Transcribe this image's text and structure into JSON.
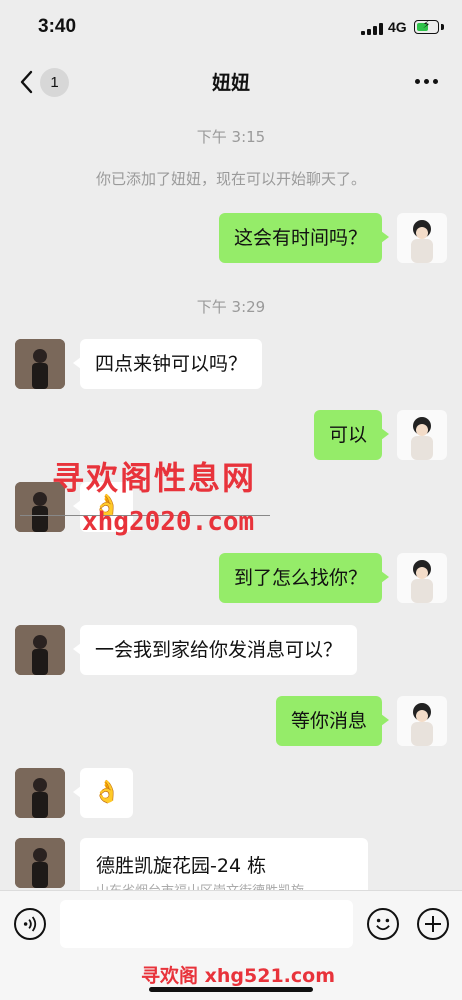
{
  "status_bar": {
    "time": "3:40",
    "network": "4G",
    "battery_level": 0.6
  },
  "header": {
    "back_badge": "1",
    "title": "妞妞"
  },
  "system": {
    "timestamp_1": "下午 3:15",
    "added_notice": "你已添加了妞妞，现在可以开始聊天了。",
    "timestamp_2": "下午 3:29"
  },
  "messages": [
    {
      "side": "me",
      "text": "这会有时间吗？"
    },
    {
      "side": "her",
      "text": "四点来钟可以吗？"
    },
    {
      "side": "me",
      "text": "可以"
    },
    {
      "side": "her",
      "text": "👌"
    },
    {
      "side": "me",
      "text": "到了怎么找你？"
    },
    {
      "side": "her",
      "text": "一会我到家给你发消息可以？"
    },
    {
      "side": "me",
      "text": "等你消息"
    },
    {
      "side": "her",
      "text": "👌"
    }
  ],
  "location_card": {
    "title": "德胜凯旋花园-24 栋",
    "address": "山东省烟台市福山区崇文街德胜凯旋"
  },
  "watermarks": {
    "chinese": "寻欢阁性息网",
    "url": "xhg2020.com",
    "bottom": "寻欢阁 xhg521.com"
  },
  "input": {
    "placeholder": ""
  },
  "icons": {
    "back": "chevron-left-icon",
    "more": "more-dots-icon",
    "voice": "voice-icon",
    "emoji": "emoji-icon",
    "plus": "plus-icon"
  },
  "colors": {
    "outgoing_bubble": "#95ec69",
    "incoming_bubble": "#ffffff",
    "background": "#ededed",
    "watermark": "#e8333b"
  }
}
